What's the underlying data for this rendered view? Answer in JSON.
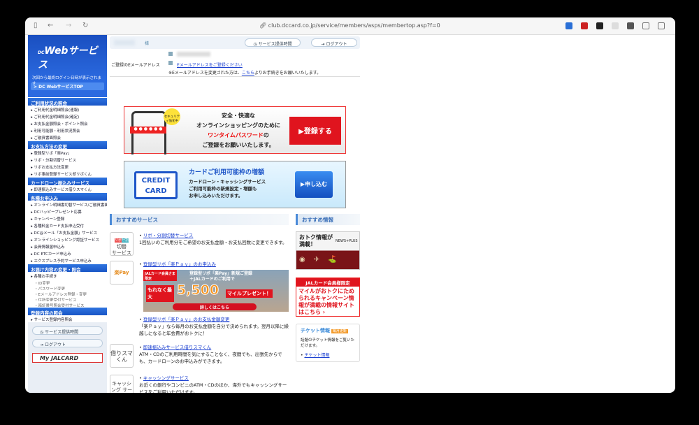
{
  "browser": {
    "url": "club.dccard.co.jp/service/members/asps/membertop.asp?f=0"
  },
  "sidebar": {
    "logo": "Webサービス",
    "logo_small": "DC",
    "login_note": "次回から最終ログイン日時が表示されます",
    "top_button": "> DC WebサービスTOP",
    "sections": [
      {
        "title": "ご利用状況の照会",
        "items": [
          "ご利用代金明細照会(速報)",
          "ご利用代金明細照会(確定)",
          "お支払金額照会・ポイント照会",
          "利用可能額・利用状況照会",
          "ご融資書面照会"
        ]
      },
      {
        "title": "お支払方法の変更",
        "items": [
          "登録型リボ「楽Pay」",
          "リボ・分割切替サービス",
          "リボお支払方法変更",
          "リボ事前登録サービス却リボくん"
        ]
      },
      {
        "title": "カードローン振込みサービス",
        "items": [
          "即速振込みサービス借りスマくん"
        ]
      },
      {
        "title": "各種お申込み",
        "items": [
          "オンライン明細書切替サービス/ご融資書面等通知サービス",
          "DCハッピープレゼント応募",
          "キャンペーン登録",
          "各種料金カード支払申込受付",
          "DC@メール「お支払金額」サービス",
          "オンラインショッピング認証サービス",
          "会員情報届申込み",
          "DC ETCカード申込み",
          "エクスプレス予約サービス申込み"
        ]
      },
      {
        "title": "お届け内容の変更・照会",
        "items": [
          "各種お手続き"
        ],
        "subitems": [
          "ID変更",
          "パスワード変更",
          "Eメールアドレス登録・変更",
          "住所変更受付サービス",
          "暗証番号照会受付サービス"
        ]
      },
      {
        "title": "登録内容の照会",
        "items": [
          "サービス登録内容照会"
        ]
      }
    ],
    "service_hours": "サービス提供時間",
    "logout": "ログアウト",
    "jal": "My JALCARD"
  },
  "header": {
    "honorific": "様",
    "service_hours": "サービス提供時間",
    "logout": "ログアウト"
  },
  "email": {
    "label": "ご登録のEメールアドレス",
    "register_link": "Eメールアドレスをご登録ください",
    "note_pre": "※Eメールアドレスを変更された方は、",
    "note_link": "こちら",
    "note_post": "よりお手続きをお願いいたします。"
  },
  "banner1": {
    "badge": "セキュリティ強化中",
    "l1": "安全・快適な",
    "l2": "オンラインショッピングのために",
    "l3": "ワンタイムパスワード",
    "l3b": "の",
    "l4": "ご登録をお願いいたします。",
    "button": "▶登録する"
  },
  "banner2": {
    "card1": "CREDIT",
    "card2": "CARD",
    "title": "カードご利用可能枠の増額",
    "l1": "カードローン・キャッシングサービス",
    "l2": "ご利用可能枠の新規設定・増額も",
    "l3": "お申し込みいただけます。",
    "button": "▶申し込む"
  },
  "recommended_services": {
    "title": "おすすめサービス",
    "items": [
      {
        "icon": "リボ 分割 切替 サービス",
        "link": "リボ・分割切替サービス",
        "desc": "1回払いのご利用分をご希望のお支払金額・お支払回数に変更できます。"
      },
      {
        "icon": "楽Pay",
        "link": "登録型リボ「楽Ｐａｙ」のお申込み",
        "desc": ""
      },
      {
        "icon": "",
        "link": "登録型リボ「楽Ｐａｙ」のお支払金額変更",
        "desc": "「楽Ｐａｙ」なら毎月のお支払金額を自分で決められます。翌月以降に繰越しになると年会費がおトクに！"
      },
      {
        "icon": "借りスマくん",
        "link": "即速振込みサービス借りスマくん",
        "desc": "ATM・CDのご利用時間を気にすることなく、夜間でも、出張先からでも、カードローンのお申込みができます。"
      },
      {
        "icon": "キャッシング サービス",
        "link": "キャッシングサービス",
        "desc": "お近くの銀行やコンビニのATM・CDのほか、海外でもキャッシングサービスをご利用いただけます。"
      }
    ]
  },
  "promo": {
    "tag": "JALカード会員さま限定",
    "l1": "登録型リボ「楽Pay」新規ご登録",
    "l2": "＋JALカードのご利用で",
    "l3": "もれなく最大",
    "amount": "5,500",
    "l4": "マイルプレゼント！",
    "button": "詳しくはこちら"
  },
  "recommended_info": {
    "title": "おすすめ情報",
    "news": {
      "text": "おトク情報が満載！",
      "brand": "NEWS+PLUS"
    },
    "jal": {
      "tag": "JALカード会員様限定",
      "text": "マイルがおトクにためられるキャンペーン情報が満載の情報サイトはこちら ›"
    },
    "ticket": {
      "title": "チケット情報",
      "badge": "毎月更新",
      "desc": "話題のチケット情報をご覧いただけます。",
      "link": "チケット情報"
    }
  }
}
